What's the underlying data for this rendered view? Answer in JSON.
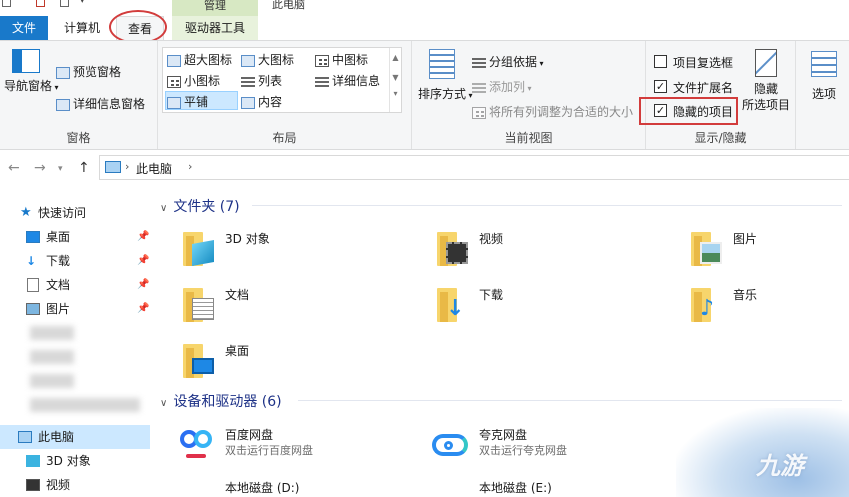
{
  "window": {
    "title": "此电脑"
  },
  "tabs": {
    "file": "文件",
    "computer": "计算机",
    "view": "查看",
    "context_group": "管理",
    "drive_tools": "驱动器工具"
  },
  "ribbon": {
    "pane": {
      "nav_pane": "导航窗格",
      "preview_pane": "预览窗格",
      "details_pane": "详细信息窗格",
      "label": "窗格"
    },
    "layout": {
      "items": [
        "超大图标",
        "大图标",
        "中图标",
        "小图标",
        "列表",
        "详细信息",
        "平铺",
        "内容"
      ],
      "selected": "平铺",
      "label": "布局"
    },
    "current_view": {
      "sort_by": "排序方式",
      "group_by": "分组依据",
      "add_columns": "添加列",
      "size_columns": "将所有列调整为合适的大小",
      "label": "当前视图"
    },
    "show_hide": {
      "item_checkboxes": "项目复选框",
      "file_extensions": "文件扩展名",
      "hidden_items": "隐藏的项目",
      "item_checkboxes_checked": false,
      "file_extensions_checked": true,
      "hidden_items_checked": true,
      "hide_selected_line1": "隐藏",
      "hide_selected_line2": "所选项目",
      "label": "显示/隐藏"
    },
    "options": "选项"
  },
  "address": {
    "location": "此电脑"
  },
  "nav": {
    "quick_access": "快速访问",
    "desktop": "桌面",
    "downloads": "下载",
    "documents": "文档",
    "pictures": "图片",
    "this_pc": "此电脑",
    "objects3d": "3D 对象",
    "videos": "视频"
  },
  "content": {
    "folders_header": "文件夹 (7)",
    "folders": [
      "3D 对象",
      "视频",
      "图片",
      "文档",
      "下载",
      "音乐",
      "桌面"
    ],
    "devices_header": "设备和驱动器 (6)",
    "devices": [
      {
        "name": "百度网盘",
        "sub": "双击运行百度网盘"
      },
      {
        "name": "夸克网盘",
        "sub": "双击运行夸克网盘"
      }
    ],
    "drives": [
      "本地磁盘 (D:)",
      "本地磁盘 (E:)"
    ]
  },
  "watermark": "九游"
}
